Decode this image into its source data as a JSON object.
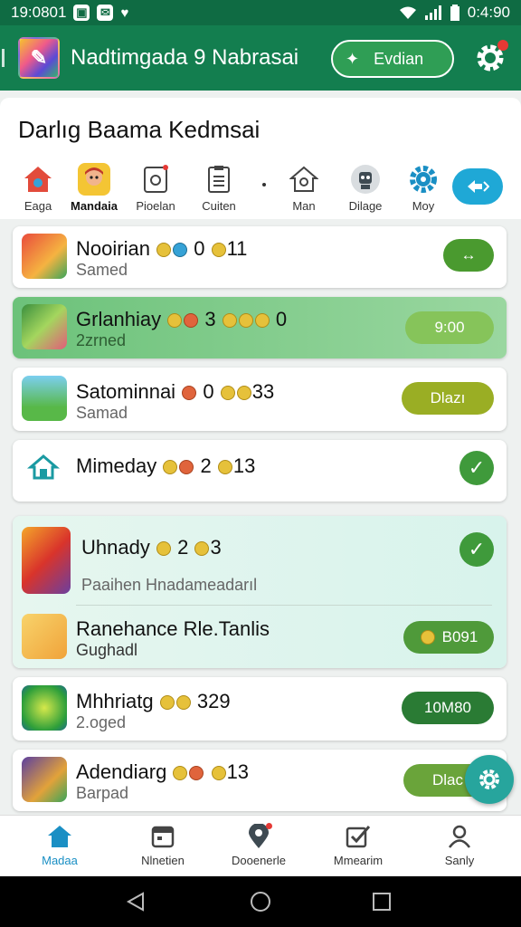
{
  "status_bar": {
    "left_time": "19:0801",
    "right_time": "0:4:90",
    "icons": [
      "photo-icon",
      "message-icon",
      "heart-icon",
      "wifi-icon",
      "signal-icon",
      "battery-icon"
    ]
  },
  "app_bar": {
    "title": "Nadtimgada 9 Nabrasai",
    "action_label": "Evdian",
    "colors": {
      "bar": "#137e4f",
      "action": "#2f9e55"
    }
  },
  "section": {
    "title": "Darlıg Baama Kedmsai"
  },
  "categories": [
    {
      "label": "Eaga",
      "icon": "home-icon"
    },
    {
      "label": "Mandaia",
      "icon": "character-icon"
    },
    {
      "label": "Pioelan",
      "icon": "receipt-icon"
    },
    {
      "label": "Cuiten",
      "icon": "document-icon"
    },
    {
      "label": "Man",
      "icon": "house-outline-icon"
    },
    {
      "label": "Dilage",
      "icon": "robot-icon"
    },
    {
      "label": "Moy",
      "icon": "puzzle-gear-icon"
    }
  ],
  "rows": [
    {
      "name": "Nooirian",
      "stats": "0",
      "stats2": "11",
      "sub": "Samed",
      "action_type": "pill",
      "action_label": "↔",
      "action_color": "#4a9a2f"
    },
    {
      "name": "Grlanhiay",
      "stats": "3",
      "stats2": "0",
      "sub": "2zrned",
      "action_type": "pill",
      "action_label": "9:00",
      "action_color": "#86c45a"
    },
    {
      "name": "Satominnai",
      "stats": "0",
      "stats2": "33",
      "sub": "Samad",
      "action_type": "pill",
      "action_label": "Dlazı",
      "action_color": "#9aae24"
    },
    {
      "name": "Mimeday",
      "stats": "2",
      "stats2": "13",
      "sub": "",
      "action_type": "check"
    },
    {
      "name": "Uhnady",
      "stats": "2",
      "stats2": "3",
      "sub": "Paaihen Hnadameadarıl",
      "action_type": "check"
    },
    {
      "name": "Ranehance Rle.Tanlis",
      "stats": "",
      "stats2": "",
      "sub": "Gughadl",
      "action_type": "pill",
      "action_label": "B091",
      "action_color": "#4f9a3a"
    },
    {
      "name": "Mhhriatg",
      "stats": "",
      "stats2": "329",
      "sub": "2.oged",
      "action_type": "pill",
      "action_label": "10M80",
      "action_color": "#2a7b34"
    },
    {
      "name": "Adendiarg",
      "stats": "",
      "stats2": "13",
      "sub": "Barpad",
      "action_type": "pill",
      "action_label": "Dlac",
      "action_color": "#6aa43a"
    }
  ],
  "bottom_nav": [
    {
      "label": "Madaa",
      "icon": "home-icon",
      "active": true
    },
    {
      "label": "Nlnetien",
      "icon": "calendar-icon",
      "active": false
    },
    {
      "label": "Dooenerle",
      "icon": "location-icon",
      "active": false
    },
    {
      "label": "Mmearim",
      "icon": "checkbox-icon",
      "active": false
    },
    {
      "label": "Sanly",
      "icon": "person-icon",
      "active": false
    }
  ]
}
